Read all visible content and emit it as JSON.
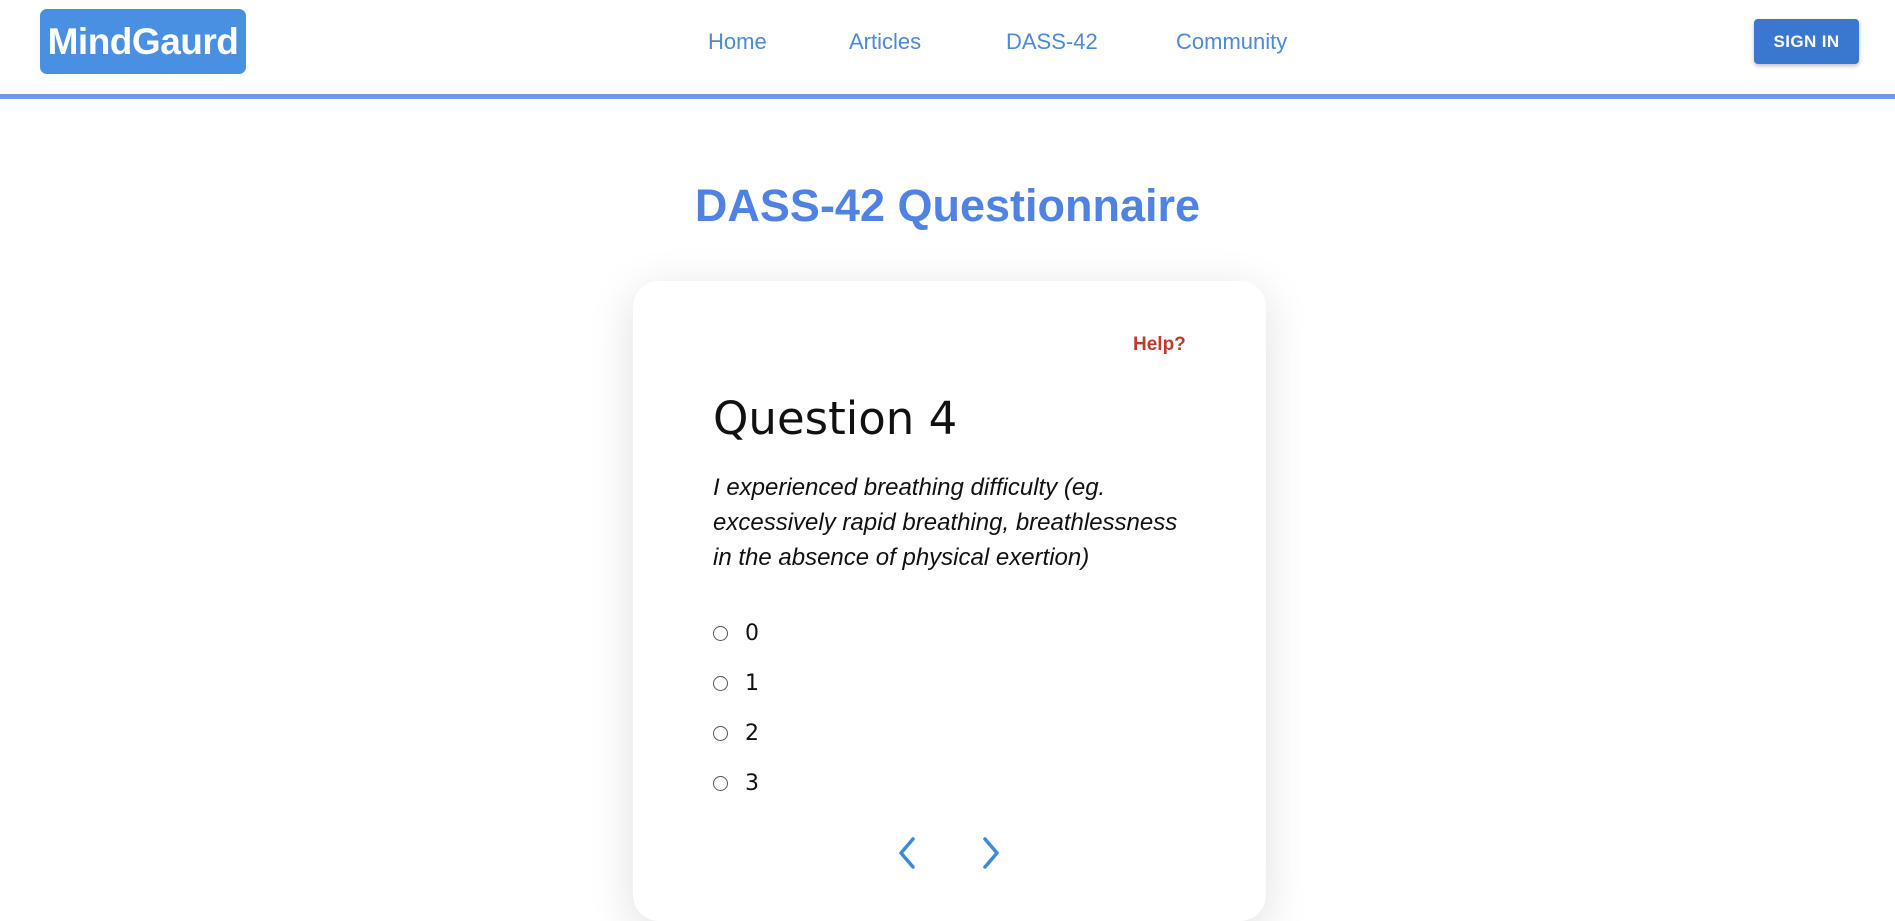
{
  "brand": {
    "name": "MindGaurd",
    "color": "#4a90e2"
  },
  "nav": {
    "items": [
      {
        "label": "Home"
      },
      {
        "label": "Articles"
      },
      {
        "label": "DASS-42"
      },
      {
        "label": "Community"
      }
    ],
    "signin_label": "SIGN IN"
  },
  "page": {
    "title": "DASS-42 Questionnaire"
  },
  "question": {
    "help_label": "Help?",
    "number_label": "Question 4",
    "text": "I experienced breathing difficulty (eg. excessively rapid breathing, breathlessness in the absence of physical exertion)",
    "options": [
      {
        "label": "0",
        "selected": false
      },
      {
        "label": "1",
        "selected": false
      },
      {
        "label": "2",
        "selected": false
      },
      {
        "label": "3",
        "selected": false
      }
    ]
  },
  "icons": {
    "prev": "chevron-left-icon",
    "next": "chevron-right-icon"
  },
  "colors": {
    "accent": "#4f82e3",
    "nav_link": "#4a8ad6",
    "header_border": "#6b9ce8",
    "help": "#c0392b",
    "signin": "#3a78d0"
  }
}
